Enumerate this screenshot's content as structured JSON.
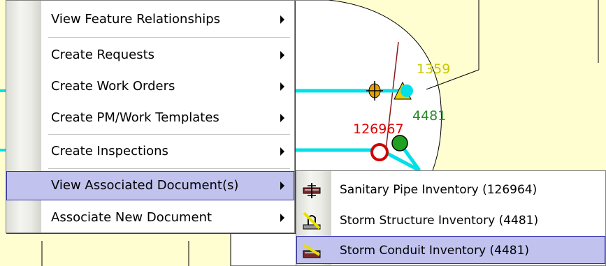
{
  "map": {
    "labels": {
      "label_1359": "1359",
      "label_4481": "4481",
      "label_126967": "126967"
    },
    "colors": {
      "background": "#fefed0",
      "pipe": "#00e0e8",
      "label_1359": "#c8c800",
      "label_4481": "#2a8a2a",
      "label_126967": "#e00000"
    }
  },
  "context_menu": {
    "items": [
      {
        "label": "View Feature Relationships",
        "has_submenu": true
      },
      {
        "label": "Create Requests",
        "has_submenu": true
      },
      {
        "label": "Create Work Orders",
        "has_submenu": true
      },
      {
        "label": "Create PM/Work Templates",
        "has_submenu": true
      },
      {
        "label": "Create Inspections",
        "has_submenu": true
      },
      {
        "label": "View Associated Document(s)",
        "has_submenu": true,
        "selected": true
      },
      {
        "label": "Associate New Document",
        "has_submenu": true
      }
    ],
    "highlight_color": "#c1c2ee"
  },
  "submenu": {
    "items": [
      {
        "label": "Sanitary Pipe Inventory (126964)",
        "icon": "sanitary-pipe-icon"
      },
      {
        "label": "Storm Structure Inventory (4481)",
        "icon": "storm-structure-icon"
      },
      {
        "label": "Storm Conduit Inventory (4481)",
        "icon": "storm-conduit-icon",
        "selected": true
      }
    ]
  }
}
